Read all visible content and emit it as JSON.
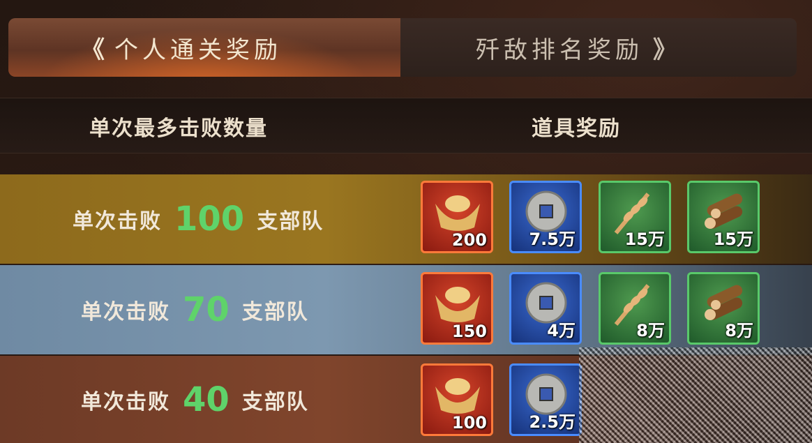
{
  "tabs": {
    "left": {
      "chevron": "《",
      "label": "个人通关奖励"
    },
    "right": {
      "label": "歼敌排名奖励",
      "chevron": "》"
    }
  },
  "header": {
    "col_left": "单次最多击败数量",
    "col_right": "道具奖励"
  },
  "rows": [
    {
      "prefix": "单次击败",
      "count": "100",
      "suffix": "支部队",
      "rewards": [
        {
          "icon": "gold-ingot-icon",
          "qty": "200"
        },
        {
          "icon": "copper-coin-icon",
          "qty": "7.5万"
        },
        {
          "icon": "wheat-icon",
          "qty": "15万"
        },
        {
          "icon": "wood-logs-icon",
          "qty": "15万"
        }
      ]
    },
    {
      "prefix": "单次击败",
      "count": "70",
      "suffix": "支部队",
      "rewards": [
        {
          "icon": "gold-ingot-icon",
          "qty": "150"
        },
        {
          "icon": "copper-coin-icon",
          "qty": "4万"
        },
        {
          "icon": "wheat-icon",
          "qty": "8万"
        },
        {
          "icon": "wood-logs-icon",
          "qty": "8万"
        }
      ]
    },
    {
      "prefix": "单次击败",
      "count": "40",
      "suffix": "支部队",
      "rewards": [
        {
          "icon": "gold-ingot-icon",
          "qty": "100"
        },
        {
          "icon": "copper-coin-icon",
          "qty": "2.5万"
        }
      ]
    }
  ],
  "colors": {
    "count_green": "#5fd36a",
    "row_gold": "#9a7620",
    "row_blue": "#7d98b0",
    "row_brown": "#80452c"
  }
}
